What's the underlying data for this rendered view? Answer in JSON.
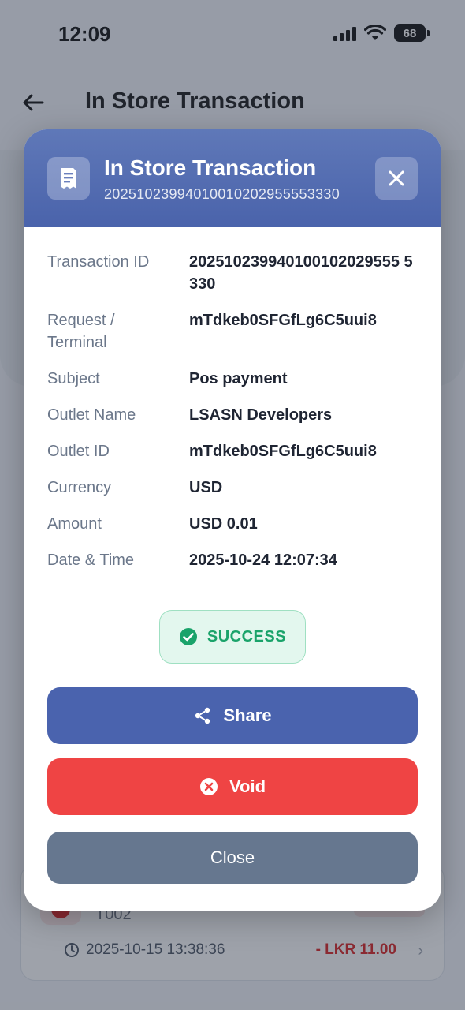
{
  "status_bar": {
    "time": "12:09",
    "battery": "68"
  },
  "app_header": {
    "title": "In Store Transaction"
  },
  "background_card": {
    "code": "T002",
    "date": "2025-10-15 13:38:36",
    "amount": "- LKR 11.00"
  },
  "modal": {
    "title": "In Store Transaction",
    "subtitle": "20251023994010010202955553330",
    "details": [
      {
        "label": "Transaction ID",
        "value": "202510239940100102029555 5330"
      },
      {
        "label": "Request / Terminal",
        "value": "mTdkeb0SFGfLg6C5uui8"
      },
      {
        "label": "Subject",
        "value": "Pos payment"
      },
      {
        "label": "Outlet Name",
        "value": "LSASN Developers"
      },
      {
        "label": "Outlet ID",
        "value": "mTdkeb0SFGfLg6C5uui8"
      },
      {
        "label": "Currency",
        "value": "USD"
      },
      {
        "label": "Amount",
        "value": "USD 0.01"
      },
      {
        "label": "Date & Time",
        "value": "2025-10-24 12:07:34"
      }
    ],
    "status": "SUCCESS",
    "buttons": {
      "share": "Share",
      "void": "Void",
      "close": "Close"
    }
  },
  "colors": {
    "header_blue": "#4a63ab",
    "share_blue": "#4a63ae",
    "void_red": "#ef4444",
    "close_gray": "#66778f",
    "success_green": "#1aa36a"
  }
}
